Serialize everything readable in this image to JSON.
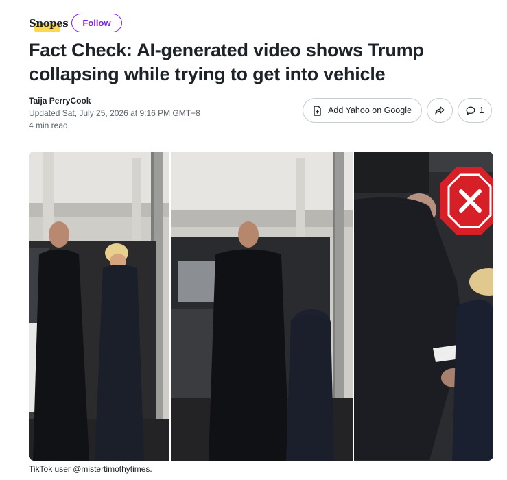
{
  "brand": {
    "logo_text": "Snopes",
    "follow_label": "Follow",
    "accent": "#7e1fff"
  },
  "article": {
    "title": "Fact Check: AI-generated video shows Trump collapsing while trying to get into vehicle",
    "author": "Taija PerryCook",
    "updated": "Updated Sat, July 25, 2026 at 9:16 PM GMT+8",
    "read_time": "4 min read"
  },
  "actions": {
    "add_google_label": "Add Yahoo on Google",
    "share_icon": "share-arrow-icon",
    "comment_icon": "comment-bubble-icon",
    "comment_count": "1"
  },
  "media": {
    "panels": 3,
    "badge_icon": "red-x-octagon-icon",
    "badge_color": "#d61f26",
    "caption": "TikTok user @mistertimothytimes."
  }
}
